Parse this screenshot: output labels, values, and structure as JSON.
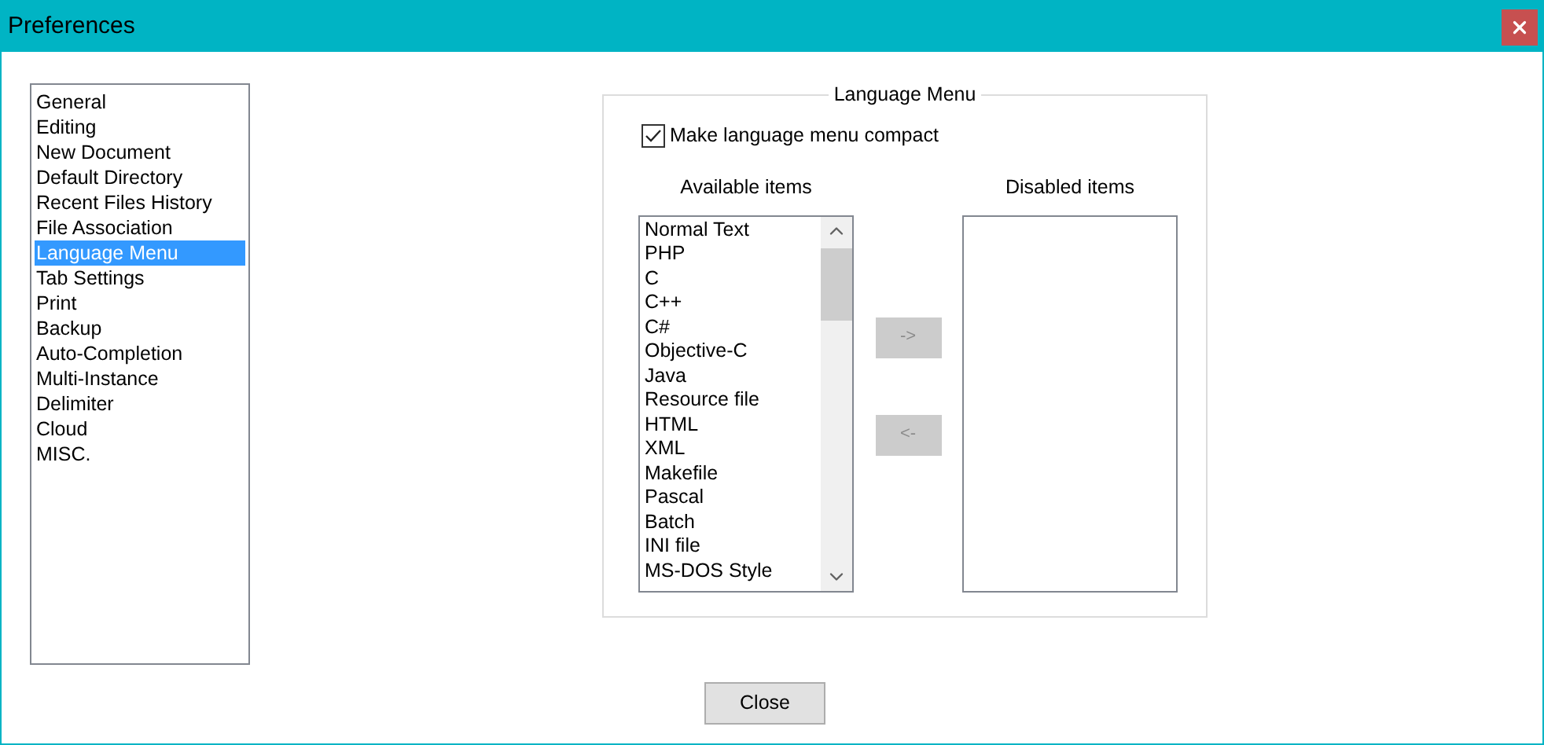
{
  "window": {
    "title": "Preferences"
  },
  "sidebar": {
    "items": [
      {
        "label": "General",
        "selected": false
      },
      {
        "label": "Editing",
        "selected": false
      },
      {
        "label": "New Document",
        "selected": false
      },
      {
        "label": "Default Directory",
        "selected": false
      },
      {
        "label": "Recent Files History",
        "selected": false
      },
      {
        "label": "File Association",
        "selected": false
      },
      {
        "label": "Language Menu",
        "selected": true
      },
      {
        "label": "Tab Settings",
        "selected": false
      },
      {
        "label": "Print",
        "selected": false
      },
      {
        "label": "Backup",
        "selected": false
      },
      {
        "label": "Auto-Completion",
        "selected": false
      },
      {
        "label": "Multi-Instance",
        "selected": false
      },
      {
        "label": "Delimiter",
        "selected": false
      },
      {
        "label": "Cloud",
        "selected": false
      },
      {
        "label": "MISC.",
        "selected": false
      }
    ]
  },
  "group": {
    "title": "Language Menu",
    "compact": {
      "label": "Make language menu compact",
      "checked": true
    },
    "available": {
      "label": "Available items",
      "items": [
        "Normal Text",
        "PHP",
        "C",
        "C++",
        "C#",
        "Objective-C",
        "Java",
        "Resource file",
        "HTML",
        "XML",
        "Makefile",
        "Pascal",
        "Batch",
        "INI file",
        "MS-DOS Style"
      ]
    },
    "move_buttons": [
      {
        "label": "->",
        "disabled": true
      },
      {
        "label": "<-",
        "disabled": true
      }
    ],
    "disabled_list": {
      "label": "Disabled items"
    }
  },
  "buttons": [
    {
      "label": "Close",
      "disabled": false
    }
  ]
}
